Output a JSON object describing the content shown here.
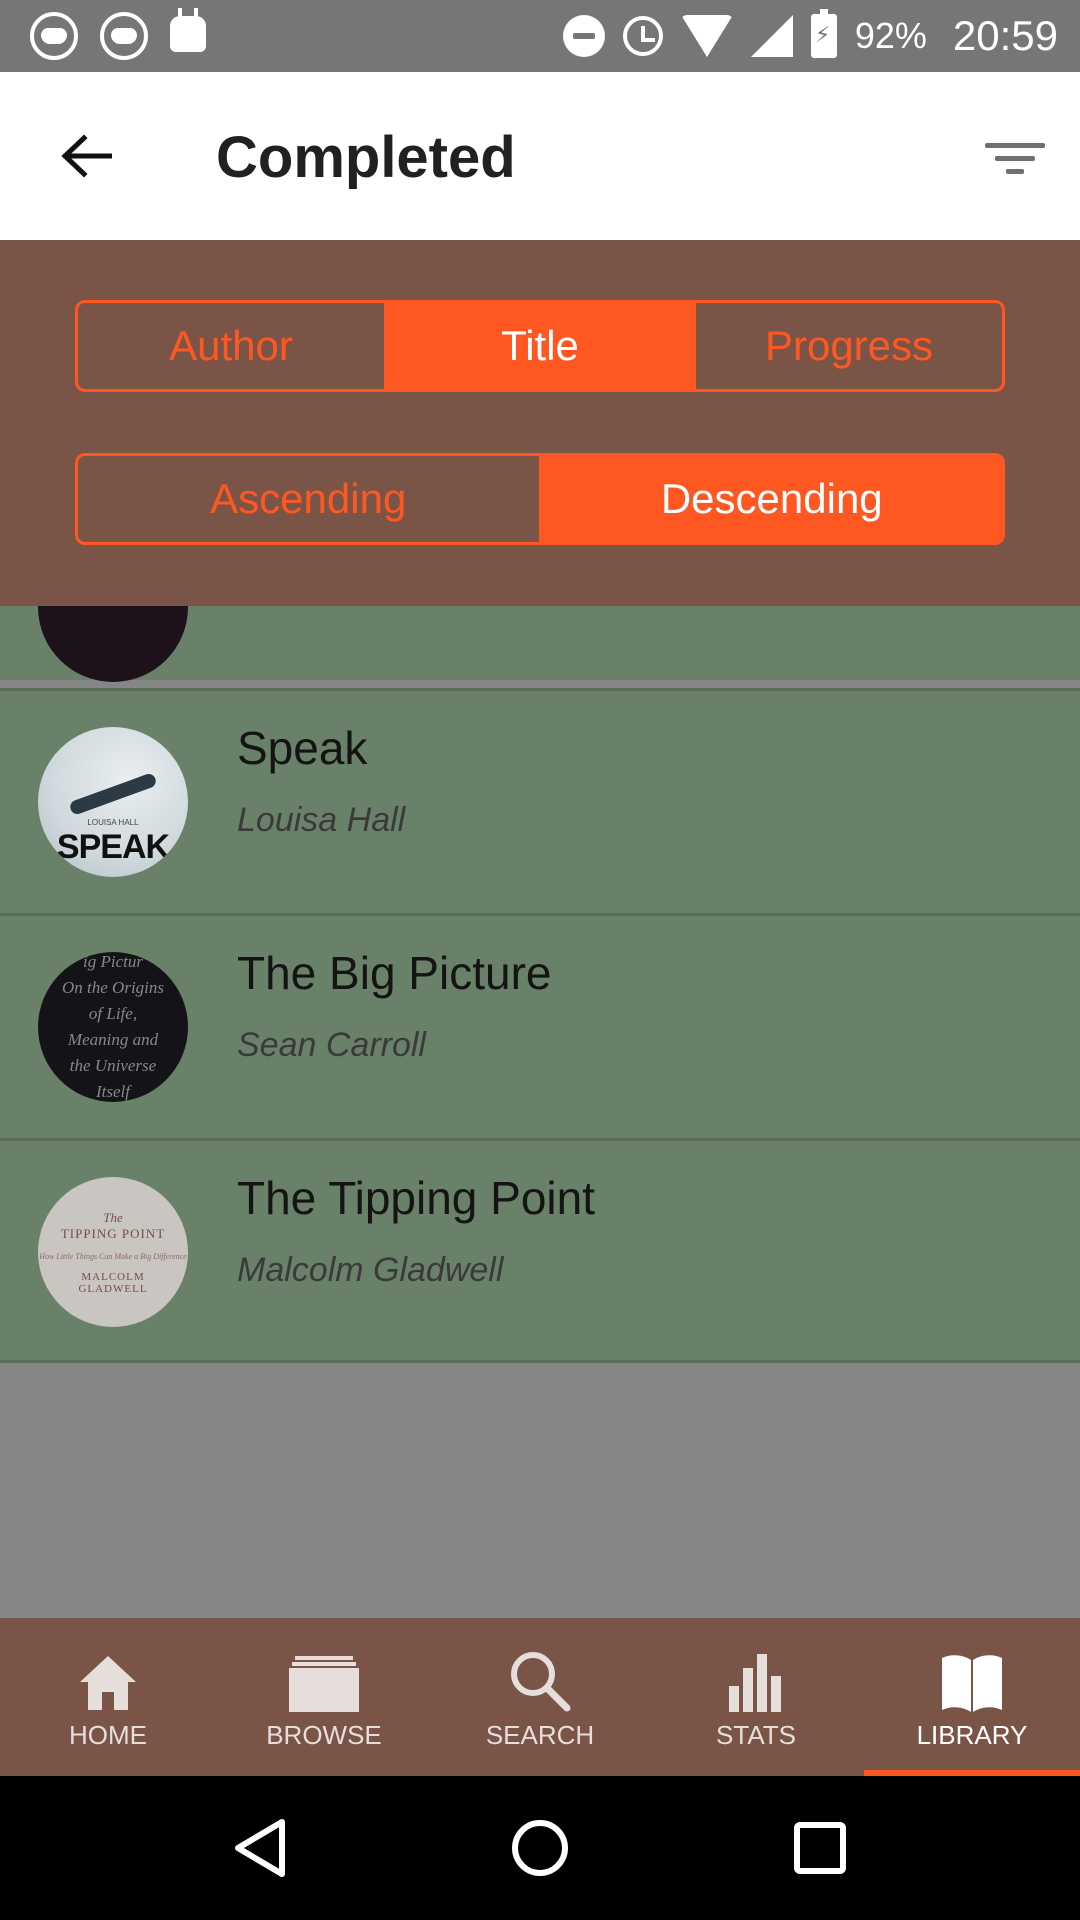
{
  "status_bar": {
    "battery": "92%",
    "time": "20:59"
  },
  "app_bar": {
    "title": "Completed"
  },
  "sort_panel": {
    "sort_by": [
      {
        "label": "Author",
        "active": false
      },
      {
        "label": "Title",
        "active": true
      },
      {
        "label": "Progress",
        "active": false
      }
    ],
    "order": [
      {
        "label": "Ascending",
        "active": false
      },
      {
        "label": "Descending",
        "active": true
      }
    ]
  },
  "books": [
    {
      "title": "Speak",
      "author": "Louisa Hall",
      "cover_text": "SPEAK",
      "cover_small": "LOUISA HALL"
    },
    {
      "title": "The Big Picture",
      "author": "Sean Carroll",
      "cover_lines": [
        "ig Pictur",
        "On the Origins",
        "of Life,",
        "Meaning and",
        "the Universe",
        "Itself"
      ]
    },
    {
      "title": "The Tipping Point",
      "author": "Malcolm Gladwell",
      "cover_lines": [
        "The",
        "TIPPING POINT",
        "How Little Things Can Make a Big Difference",
        "MALCOLM",
        "GLADWELL"
      ]
    }
  ],
  "bottom_nav": [
    {
      "label": "HOME",
      "icon": "home-icon"
    },
    {
      "label": "BROWSE",
      "icon": "browse-icon"
    },
    {
      "label": "SEARCH",
      "icon": "search-icon"
    },
    {
      "label": "STATS",
      "icon": "stats-icon"
    },
    {
      "label": "LIBRARY",
      "icon": "library-icon",
      "active": true
    }
  ],
  "colors": {
    "accent": "#ff5722",
    "panel": "#7a5547",
    "list_bg": "#6a8169",
    "overlay": "#868686"
  }
}
